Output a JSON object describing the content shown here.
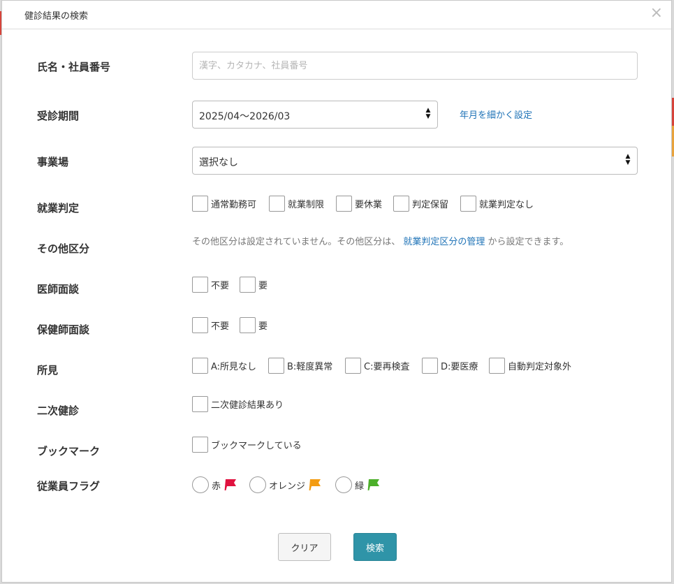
{
  "modal": {
    "title": "健診結果の検索",
    "close_symbol": "×"
  },
  "fields": {
    "name": {
      "label": "氏名・社員番号",
      "value": "",
      "placeholder": "漢字、カタカナ、社員番号"
    },
    "period": {
      "label": "受診期間",
      "value": "2025/04〜2026/03",
      "link": "年月を細かく設定"
    },
    "workplace": {
      "label": "事業場",
      "value": "選択なし"
    },
    "employment_judgement": {
      "label": "就業判定",
      "options": [
        "通常勤務可",
        "就業制限",
        "要休業",
        "判定保留",
        "就業判定なし"
      ]
    },
    "other_category": {
      "label": "その他区分",
      "note_before": "その他区分は設定されていません。その他区分は、",
      "note_link": "就業判定区分の管理",
      "note_after": "から設定できます。"
    },
    "doctor_interview": {
      "label": "医師面談",
      "options": [
        "不要",
        "要"
      ]
    },
    "nurse_interview": {
      "label": "保健師面談",
      "options": [
        "不要",
        "要"
      ]
    },
    "findings": {
      "label": "所見",
      "options": [
        "A:所見なし",
        "B:軽度異常",
        "C:要再検査",
        "D:要医療",
        "自動判定対象外"
      ]
    },
    "secondary_checkup": {
      "label": "二次健診",
      "option": "二次健診結果あり"
    },
    "bookmark": {
      "label": "ブックマーク",
      "option": "ブックマークしている"
    },
    "employee_flag": {
      "label": "従業員フラグ",
      "options": [
        {
          "label": "赤",
          "color": "#e0123f"
        },
        {
          "label": "オレンジ",
          "color": "#f39c12"
        },
        {
          "label": "緑",
          "color": "#4caf2a"
        }
      ]
    }
  },
  "buttons": {
    "clear": "クリア",
    "search": "検索"
  },
  "background_edges": [
    "#d6433a",
    "#e8a33c"
  ]
}
